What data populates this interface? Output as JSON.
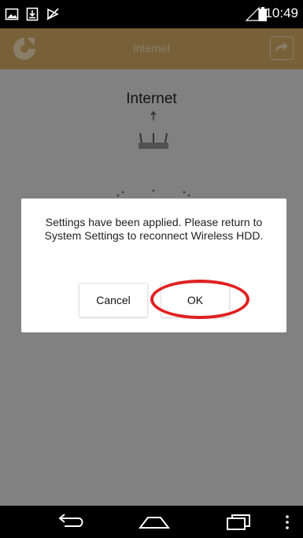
{
  "status_bar": {
    "time": "10:49",
    "icons": [
      "image-icon",
      "download-icon",
      "no-data-icon",
      "signal-icon",
      "battery-icon"
    ]
  },
  "app_bar": {
    "title": "Internet",
    "logo_icon": "app-logo-icon",
    "share_icon": "share-icon",
    "color": "#c9a25f"
  },
  "content": {
    "heading": "Internet",
    "router_icon": "router-icon"
  },
  "dialog": {
    "message": "Settings have been applied. Please return to System Settings to reconnect Wireless HDD.",
    "cancel_label": "Cancel",
    "ok_label": "OK",
    "highlight_color": "#e02020"
  },
  "nav_bar": {
    "icons": [
      "back-icon",
      "home-icon",
      "recent-apps-icon",
      "menu-icon"
    ]
  }
}
